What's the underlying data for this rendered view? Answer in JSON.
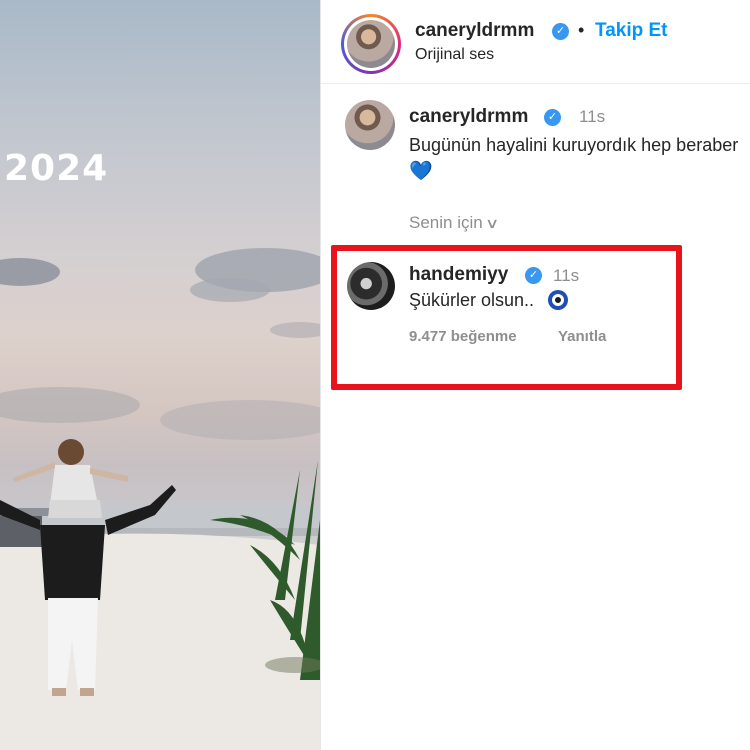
{
  "photo": {
    "year_text": "2024"
  },
  "post_header": {
    "username": "caneryldrmm",
    "verified_badge": "✓",
    "separator": "•",
    "follow_label": "Takip Et",
    "audio_label": "Orijinal ses"
  },
  "comments": [
    {
      "username": "caneryldrmm",
      "verified_badge": "✓",
      "time": "11s",
      "text": "Bugünün hayalini kuruyordık hep beraber",
      "emoji": "💙"
    },
    {
      "username": "handemiyy",
      "verified_badge": "✓",
      "time": "11s",
      "text": "Şükürler olsun..",
      "emoji_icon": "nazar-boncugu-icon",
      "likes": "9.477 beğenme",
      "reply_label": "Yanıtla",
      "highlight_color": "#e8131b"
    }
  ],
  "filter": {
    "label": "Senin için",
    "chevron": "∨"
  },
  "colors": {
    "follow_blue": "#0095f6",
    "verified_blue": "#3897f0",
    "muted_text": "#8e8e8e"
  }
}
